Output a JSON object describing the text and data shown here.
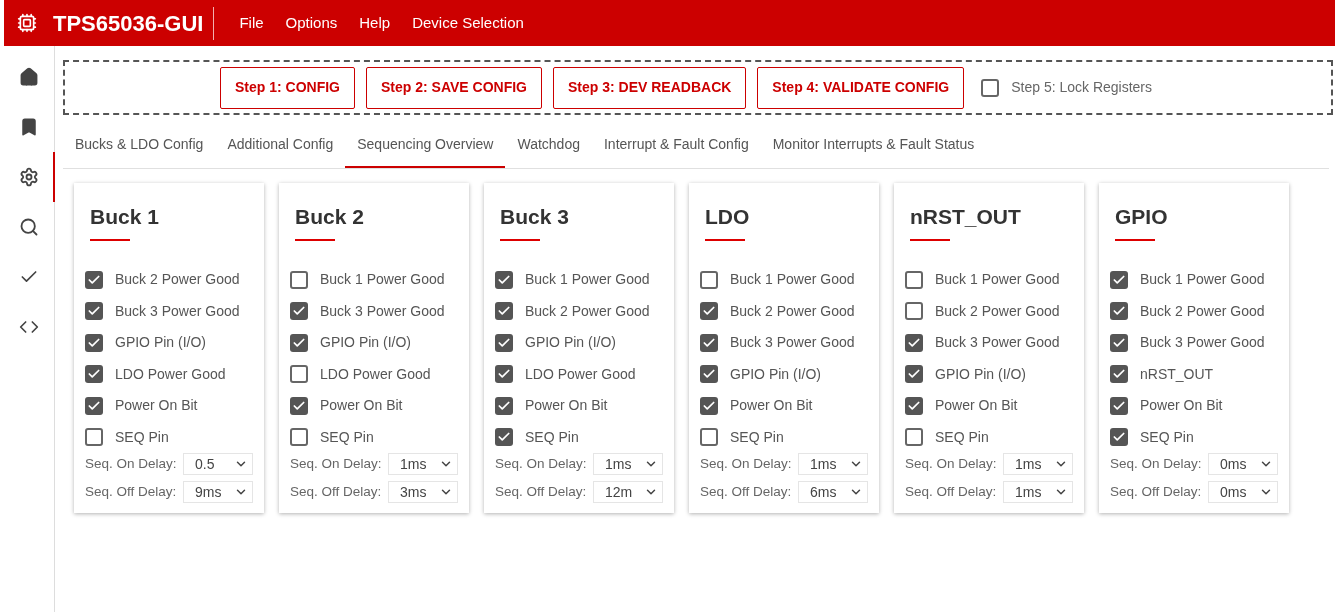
{
  "app": {
    "title": "TPS65036-GUI"
  },
  "menu": [
    "File",
    "Options",
    "Help",
    "Device Selection"
  ],
  "sidebar": {
    "items": [
      {
        "kind": "home",
        "selected": false
      },
      {
        "kind": "bookmark",
        "selected": false
      },
      {
        "kind": "settings",
        "selected": true
      },
      {
        "kind": "search",
        "selected": false
      },
      {
        "kind": "check",
        "selected": false
      },
      {
        "kind": "code",
        "selected": false
      }
    ]
  },
  "steps": {
    "buttons": [
      "Step 1: CONFIG",
      "Step 2: SAVE CONFIG",
      "Step 3: DEV READBACK",
      "Step 4: VALIDATE CONFIG"
    ],
    "lock": {
      "label": "Step 5: Lock Registers",
      "checked": false
    }
  },
  "tabs": [
    {
      "label": "Bucks & LDO Config",
      "selected": false
    },
    {
      "label": "Additional Config",
      "selected": false
    },
    {
      "label": "Sequencing Overview",
      "selected": true
    },
    {
      "label": "Watchdog",
      "selected": false
    },
    {
      "label": "Interrupt & Fault Config",
      "selected": false
    },
    {
      "label": "Monitor Interrupts & Fault Status",
      "selected": false
    }
  ],
  "cards": [
    {
      "title": "Buck 1",
      "options": [
        {
          "label": "Buck 2 Power Good",
          "checked": true
        },
        {
          "label": "Buck 3 Power Good",
          "checked": true
        },
        {
          "label": "GPIO Pin (I/O)",
          "checked": true
        },
        {
          "label": "LDO Power Good",
          "checked": true
        },
        {
          "label": "Power On Bit",
          "checked": true
        },
        {
          "label": "SEQ Pin",
          "checked": false
        }
      ],
      "delays": [
        {
          "label": "Seq. On Delay:",
          "value": "0.5"
        },
        {
          "label": "Seq. Off Delay:",
          "value": "9ms"
        }
      ]
    },
    {
      "title": "Buck 2",
      "options": [
        {
          "label": "Buck 1 Power Good",
          "checked": false
        },
        {
          "label": "Buck 3 Power Good",
          "checked": true
        },
        {
          "label": "GPIO Pin (I/O)",
          "checked": true
        },
        {
          "label": "LDO Power Good",
          "checked": false
        },
        {
          "label": "Power On Bit",
          "checked": true
        },
        {
          "label": "SEQ Pin",
          "checked": false
        }
      ],
      "delays": [
        {
          "label": "Seq. On Delay:",
          "value": "1ms"
        },
        {
          "label": "Seq. Off Delay:",
          "value": "3ms"
        }
      ]
    },
    {
      "title": "Buck 3",
      "options": [
        {
          "label": "Buck 1 Power Good",
          "checked": true
        },
        {
          "label": "Buck 2 Power Good",
          "checked": true
        },
        {
          "label": "GPIO Pin (I/O)",
          "checked": true
        },
        {
          "label": "LDO Power Good",
          "checked": true
        },
        {
          "label": "Power On Bit",
          "checked": true
        },
        {
          "label": "SEQ Pin",
          "checked": true
        }
      ],
      "delays": [
        {
          "label": "Seq. On Delay:",
          "value": "1ms"
        },
        {
          "label": "Seq. Off Delay:",
          "value": "12m"
        }
      ]
    },
    {
      "title": "LDO",
      "options": [
        {
          "label": "Buck 1 Power Good",
          "checked": false
        },
        {
          "label": "Buck 2 Power Good",
          "checked": true
        },
        {
          "label": "Buck 3 Power Good",
          "checked": true
        },
        {
          "label": "GPIO Pin (I/O)",
          "checked": true
        },
        {
          "label": "Power On Bit",
          "checked": true
        },
        {
          "label": "SEQ Pin",
          "checked": false
        }
      ],
      "delays": [
        {
          "label": "Seq. On Delay:",
          "value": "1ms"
        },
        {
          "label": "Seq. Off Delay:",
          "value": "6ms"
        }
      ]
    },
    {
      "title": "nRST_OUT",
      "options": [
        {
          "label": "Buck 1 Power Good",
          "checked": false
        },
        {
          "label": "Buck 2 Power Good",
          "checked": false
        },
        {
          "label": "Buck 3 Power Good",
          "checked": true
        },
        {
          "label": "GPIO Pin (I/O)",
          "checked": true
        },
        {
          "label": "Power On Bit",
          "checked": true
        },
        {
          "label": "SEQ Pin",
          "checked": false
        }
      ],
      "delays": [
        {
          "label": "Seq. On Delay:",
          "value": "1ms"
        },
        {
          "label": "Seq. Off Delay:",
          "value": "1ms"
        }
      ]
    },
    {
      "title": "GPIO",
      "options": [
        {
          "label": "Buck 1 Power Good",
          "checked": true
        },
        {
          "label": "Buck 2 Power Good",
          "checked": true
        },
        {
          "label": "Buck 3 Power Good",
          "checked": true
        },
        {
          "label": "nRST_OUT",
          "checked": true
        },
        {
          "label": "Power On Bit",
          "checked": true
        },
        {
          "label": "SEQ Pin",
          "checked": true
        }
      ],
      "delays": [
        {
          "label": "Seq. On Delay:",
          "value": "0ms"
        },
        {
          "label": "Seq. Off Delay:",
          "value": "0ms"
        }
      ]
    }
  ]
}
